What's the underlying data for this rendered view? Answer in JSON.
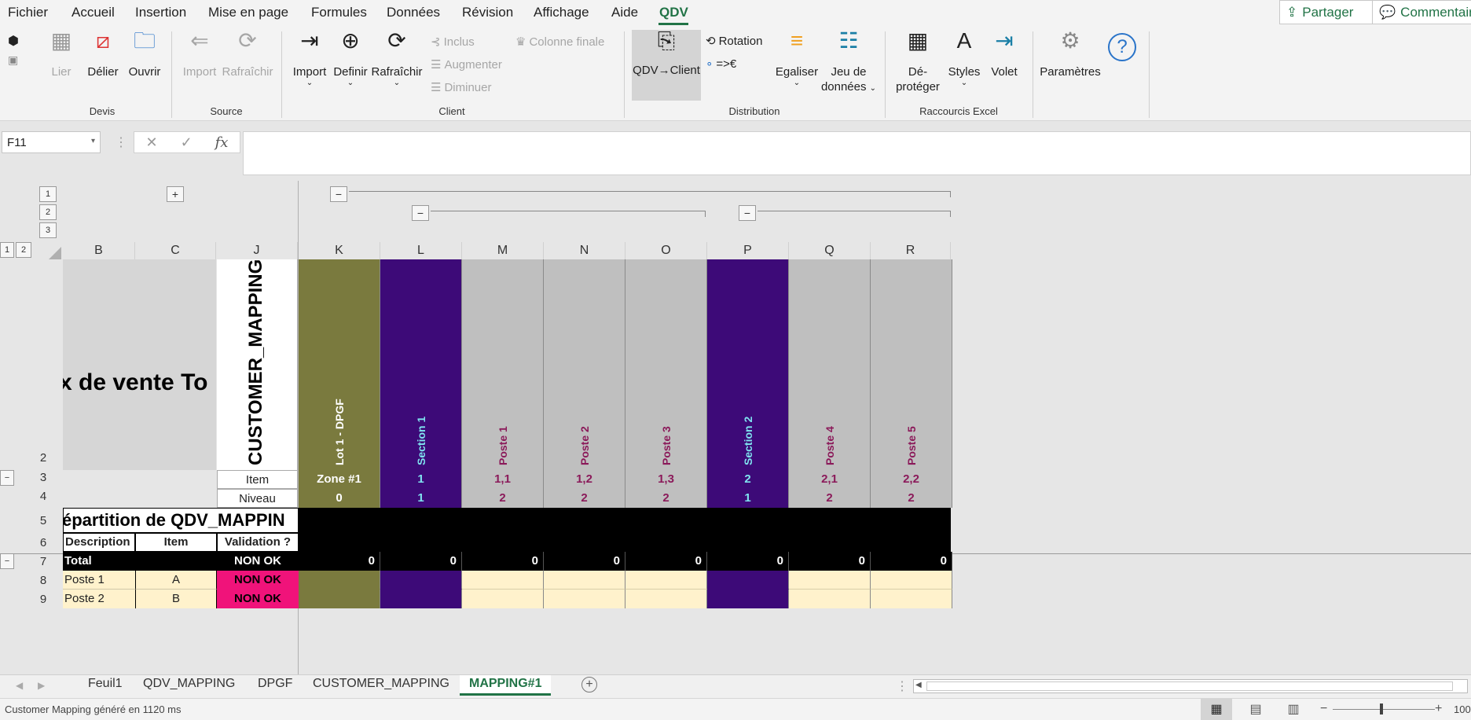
{
  "menu": [
    "Fichier",
    "Accueil",
    "Insertion",
    "Mise en page",
    "Formules",
    "Données",
    "Révision",
    "Affichage",
    "Aide",
    "QDV"
  ],
  "top_right": {
    "share": "Partager",
    "comments": "Commentair"
  },
  "ribbon": {
    "devis": {
      "label": "Devis",
      "lier": "Lier",
      "delier": "Délier",
      "ouvrir": "Ouvrir"
    },
    "source": {
      "label": "Source",
      "import": "Import",
      "rafraichir": "Rafraîchir"
    },
    "client": {
      "label": "Client",
      "import": "Import",
      "definir": "Definir",
      "rafraichir": "Rafraîchir",
      "inclus": "Inclus",
      "augmenter": "Augmenter",
      "diminuer": "Diminuer",
      "colonne_finale": "Colonne finale"
    },
    "distribution": {
      "label": "Distribution",
      "qdv_client": "QDV→Client",
      "rotation": "Rotation",
      "euro": "=>€",
      "egaliser": "Egaliser",
      "jeu1": "Jeu de",
      "jeu2": "données"
    },
    "raccourcis": {
      "label": "Raccourcis Excel",
      "deproteger1": "Dé-",
      "deproteger2": "protéger",
      "styles": "Styles",
      "volet": "Volet"
    },
    "parametres": "Paramètres"
  },
  "formula_bar": {
    "namebox": "F11",
    "fx": "fx",
    "value": ""
  },
  "outline": {
    "levels": [
      "1",
      "2",
      "3"
    ],
    "rowlevels": [
      "1",
      "2"
    ],
    "plus": "+",
    "minus": "−"
  },
  "columns": [
    "B",
    "C",
    "J",
    "K",
    "L",
    "M",
    "N",
    "O",
    "P",
    "Q",
    "R"
  ],
  "rows": [
    "2",
    "3",
    "4",
    "5",
    "6",
    "7",
    "8",
    "9"
  ],
  "sheet": {
    "title": "x de vente To",
    "customer_mapping": "CUSTOMER_MAPPING",
    "item_label": "Item",
    "niveau_label": "Niveau",
    "repartition": "épartition de QDV_MAPPIN",
    "headers": {
      "description": "Description",
      "item": "Item",
      "validation": "Validation ?"
    },
    "total": {
      "label": "Total",
      "status": "NON OK"
    },
    "postes": [
      {
        "desc": "Poste 1",
        "item": "A",
        "status": "NON OK"
      },
      {
        "desc": "Poste 2",
        "item": "B",
        "status": "NON OK"
      }
    ],
    "data_columns": [
      {
        "name": "Lot 1 - DPGF",
        "item": "Zone #1",
        "niveau": "0",
        "total": "0",
        "bg": "#7a7a3e",
        "text": "#ffffff"
      },
      {
        "name": "Section 1",
        "item": "1",
        "niveau": "1",
        "total": "0",
        "bg": "#3d0a78",
        "text": "#7fe3f0"
      },
      {
        "name": "Poste 1",
        "item": "1,1",
        "niveau": "2",
        "total": "0",
        "bg": "#bfbfbf",
        "text": "#8b1a5a"
      },
      {
        "name": "Poste 2",
        "item": "1,2",
        "niveau": "2",
        "total": "0",
        "bg": "#bfbfbf",
        "text": "#8b1a5a"
      },
      {
        "name": "Poste 3",
        "item": "1,3",
        "niveau": "2",
        "total": "0",
        "bg": "#bfbfbf",
        "text": "#8b1a5a"
      },
      {
        "name": "Section 2",
        "item": "2",
        "niveau": "1",
        "total": "0",
        "bg": "#3d0a78",
        "text": "#7fe3f0"
      },
      {
        "name": "Poste 4",
        "item": "2,1",
        "niveau": "2",
        "total": "0",
        "bg": "#bfbfbf",
        "text": "#8b1a5a"
      },
      {
        "name": "Poste 5",
        "item": "2,2",
        "niveau": "2",
        "total": "0",
        "bg": "#bfbfbf",
        "text": "#8b1a5a"
      }
    ]
  },
  "tabs": [
    "Feuil1",
    "QDV_MAPPING",
    "DPGF",
    "CUSTOMER_MAPPING",
    "MAPPING#1"
  ],
  "active_tab": "MAPPING#1",
  "status": "Customer Mapping généré en 1120 ms",
  "zoom": "100",
  "colors": {
    "accent": "#217346",
    "olive": "#7a7a3e",
    "purple": "#3d0a78",
    "pink": "#f0137a",
    "cream": "#fff2cc"
  }
}
